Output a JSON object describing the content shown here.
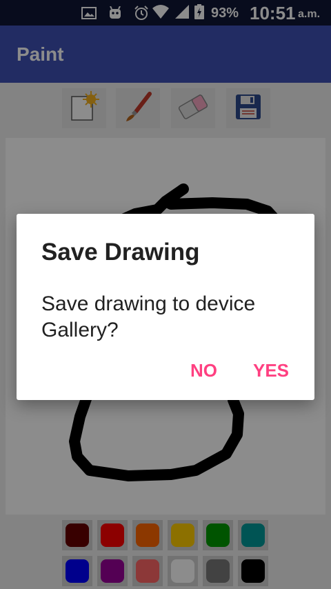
{
  "status_bar": {
    "icons": [
      "image-icon",
      "android-icon",
      "alarm-icon",
      "wifi-icon",
      "signal-icon",
      "battery-charging-icon"
    ],
    "battery": "93%",
    "time": "10:51",
    "ampm": "a.m."
  },
  "app_bar": {
    "title": "Paint"
  },
  "toolbar": {
    "tools": [
      "new-drawing-icon",
      "brush-icon",
      "eraser-icon",
      "save-icon"
    ]
  },
  "palette": {
    "colors": [
      "#660000",
      "#ff0000",
      "#ff6600",
      "#ffcc00",
      "#009900",
      "#009999",
      "#0000ff",
      "#990099",
      "#ff6666",
      "#ffffff",
      "#787878",
      "#000000"
    ]
  },
  "dialog": {
    "title": "Save Drawing",
    "message": "Save drawing to device Gallery?",
    "no_label": "NO",
    "yes_label": "YES",
    "accent": "#ff4081"
  }
}
